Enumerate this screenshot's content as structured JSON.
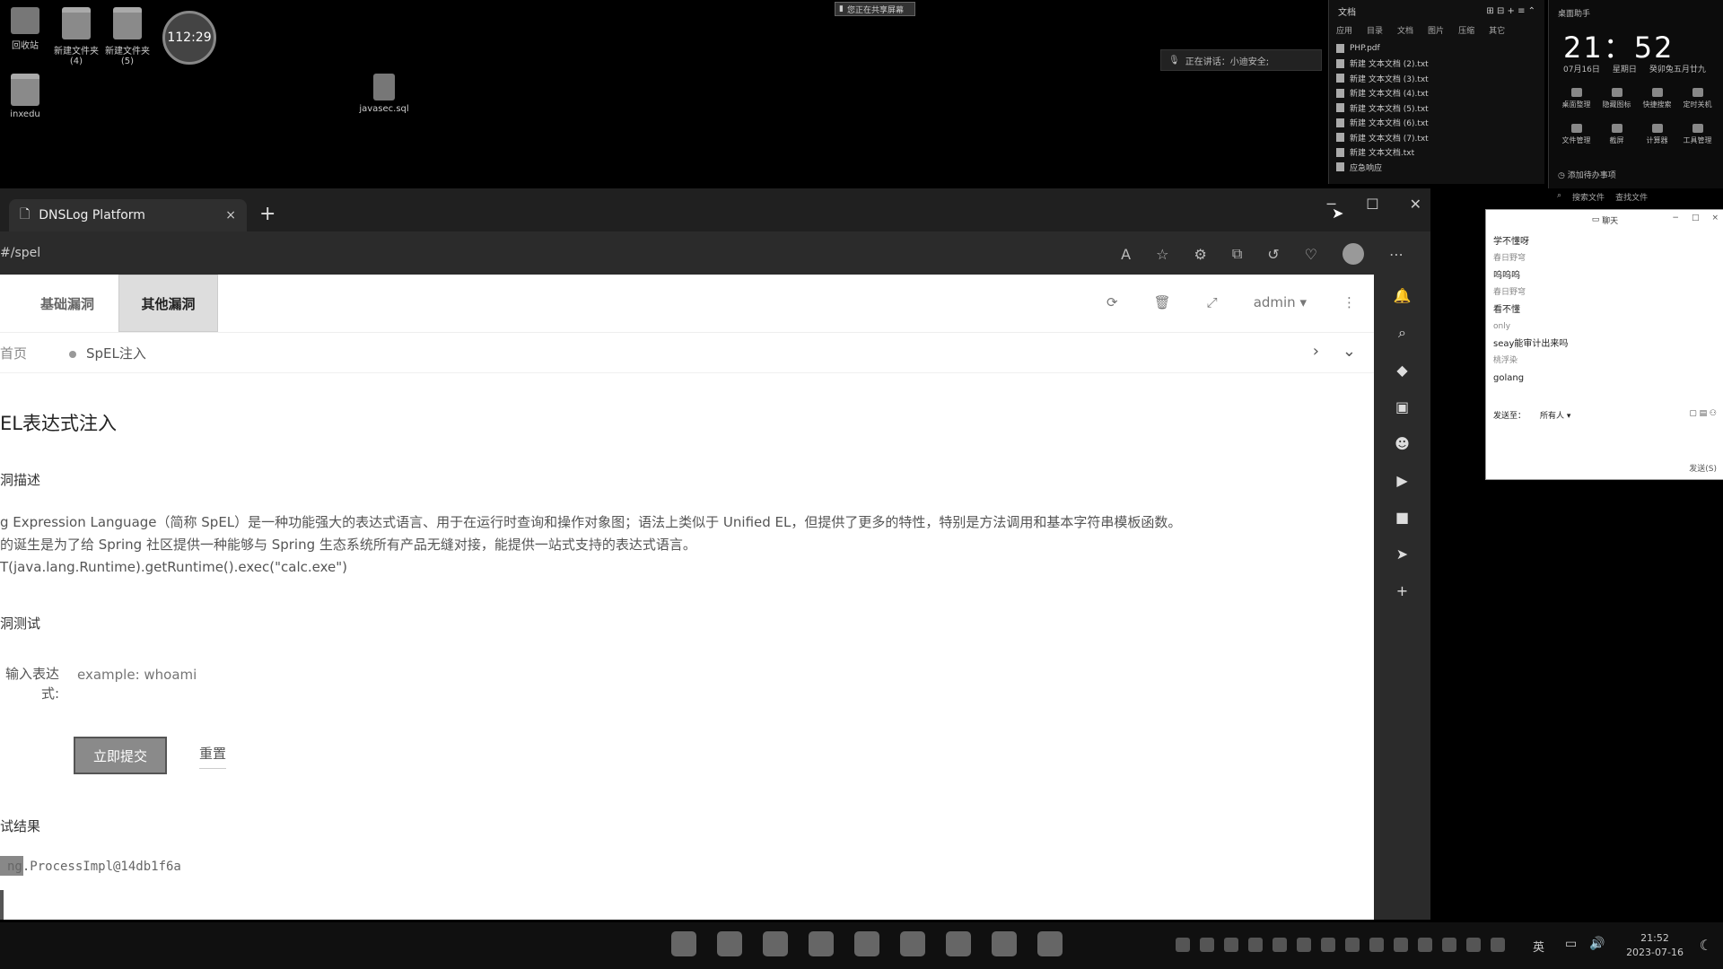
{
  "desktop": {
    "icons": [
      {
        "label": "回收站"
      },
      {
        "label": "新建文件夹\n(4)"
      },
      {
        "label": "新建文件夹\n(5)"
      },
      {
        "label": "inxedu"
      },
      {
        "label": "javasec.sql"
      }
    ],
    "clock_widget": "112:29",
    "sharing_label": "您正在共享屏幕",
    "speaking_label": "正在讲话：小迪安全;"
  },
  "file_panel": {
    "title": "文档",
    "tabs": [
      "应用",
      "目录",
      "文档",
      "图片",
      "压缩",
      "其它"
    ],
    "files": [
      "PHP.pdf",
      "新建 文本文档 (2).txt",
      "新建 文本文档 (3).txt",
      "新建 文本文档 (4).txt",
      "新建 文本文档 (5).txt",
      "新建 文本文档 (6).txt",
      "新建 文本文档 (7).txt",
      "新建 文本文档.txt",
      "应急响应"
    ]
  },
  "assistant": {
    "title": "桌面助手",
    "time": "21：52",
    "date": [
      "07月16日",
      "星期日",
      "癸卯兔五月廿九"
    ],
    "tools": [
      "桌面整理",
      "隐藏图标",
      "快捷搜索",
      "定时关机",
      "文件管理",
      "截屏",
      "计算器",
      "工具管理"
    ],
    "todo": "添加待办事项",
    "search": "搜索文件",
    "search2": "查找文件"
  },
  "chat": {
    "title": "聊天",
    "messages": [
      {
        "text": "学不懂呀",
        "type": "msg"
      },
      {
        "text": "春日野穹",
        "type": "name"
      },
      {
        "text": "呜呜呜",
        "type": "msg"
      },
      {
        "text": "春日野穹",
        "type": "name"
      },
      {
        "text": "看不懂",
        "type": "msg"
      },
      {
        "text": "only",
        "type": "name"
      },
      {
        "text": "seay能审计出来吗",
        "type": "msg"
      },
      {
        "text": "桃浮染",
        "type": "name"
      },
      {
        "text": "golang",
        "type": "msg"
      }
    ],
    "send_to_label": "发送至：",
    "send_to_value": "所有人",
    "send_button": "发送(S)"
  },
  "browser": {
    "tab_title": "DNSLog Platform",
    "url": "#/spel",
    "close_glyph": "×",
    "new_tab_glyph": "+"
  },
  "app": {
    "nav": [
      "基础漏洞",
      "其他漏洞"
    ],
    "user": "admin",
    "breadcrumb_home": "首页",
    "breadcrumb_current": "SpEL注入",
    "page_title": "EL表达式注入",
    "section_desc": "洞描述",
    "desc_lines": [
      "g Expression Language（简称 SpEL）是一种功能强大的表达式语言、用于在运行时查询和操作对象图；语法上类似于 Unified EL，但提供了更多的特性，特别是方法调用和基本字符串模板函数。",
      "的诞生是为了给 Spring 社区提供一种能够与 Spring 生态系统所有产品无缝对接，能提供一站式支持的表达式语言。",
      "T(java.lang.Runtime).getRuntime().exec(\"calc.exe\")"
    ],
    "section_test": "洞测试",
    "expr_label": "输入表达式:",
    "expr_placeholder": "example: whoami",
    "submit_label": "立即提交",
    "reset_label": "重置",
    "section_result": "试结果",
    "result_text": "ng.ProcessImpl@14db1f6a"
  },
  "taskbar": {
    "lang": "英",
    "time": "21:52",
    "date": "2023-07-16"
  }
}
